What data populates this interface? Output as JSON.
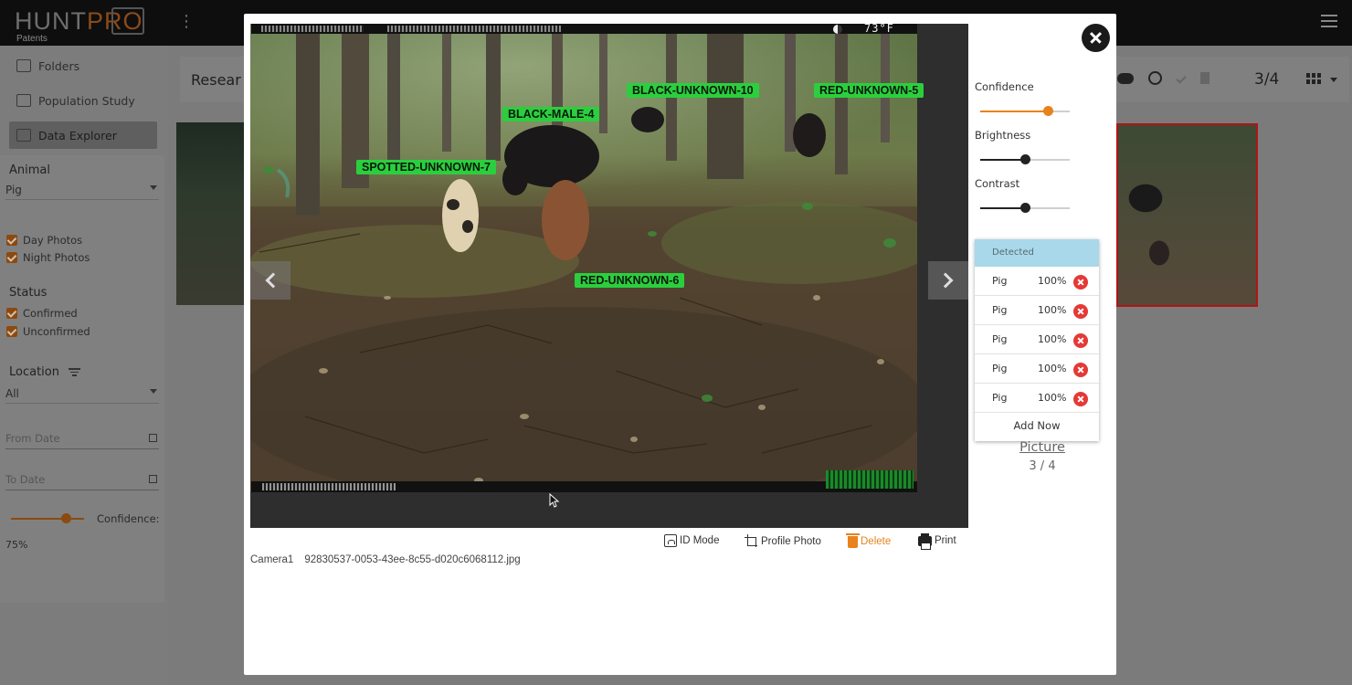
{
  "app": {
    "logo_main": "HUNT",
    "logo_accent": "PRO",
    "logo_sub": "Patents"
  },
  "sidebar": {
    "items": [
      {
        "label": "Folders",
        "icon": "folder-icon"
      },
      {
        "label": "Population Study",
        "icon": "document-icon"
      },
      {
        "label": "Data Explorer",
        "icon": "data-explorer-icon",
        "active": true
      }
    ],
    "animal_title": "Animal",
    "animal_value": "Pig",
    "day_photos": "Day Photos",
    "night_photos": "Night Photos",
    "status_title": "Status",
    "confirmed": "Confirmed",
    "unconfirmed": "Unconfirmed",
    "location_title": "Location",
    "location_value": "All",
    "from_date_placeholder": "From Date",
    "to_date_placeholder": "To Date",
    "confidence_label": "Confidence:",
    "confidence_value": "75%",
    "confidence_level": 0.75
  },
  "content": {
    "title": "Resear",
    "count": "3/4"
  },
  "viewer": {
    "temperature": "73°F",
    "detection_tags": [
      {
        "label": "BLACK-UNKNOWN-10"
      },
      {
        "label": "RED-UNKNOWN-5"
      },
      {
        "label": "BLACK-MALE-4"
      },
      {
        "label": "SPOTTED-UNKNOWN-7"
      },
      {
        "label": "RED-UNKNOWN-6"
      }
    ]
  },
  "adjustments": {
    "confidence": {
      "label": "Confidence",
      "level": 0.75,
      "color": "#e8821c"
    },
    "brightness": {
      "label": "Brightness",
      "level": 0.5,
      "color": "#222222"
    },
    "contrast": {
      "label": "Contrast",
      "level": 0.5,
      "color": "#222222"
    }
  },
  "detected": {
    "header": "Detected",
    "rows": [
      {
        "name": "Pig",
        "confidence": "100%"
      },
      {
        "name": "Pig",
        "confidence": "100%"
      },
      {
        "name": "Pig",
        "confidence": "100%"
      },
      {
        "name": "Pig",
        "confidence": "100%"
      },
      {
        "name": "Pig",
        "confidence": "100%"
      }
    ],
    "add_label": "Add Now"
  },
  "picture": {
    "label": "Picture",
    "position": "3 / 4"
  },
  "actions": {
    "id_mode": "ID Mode",
    "profile_photo": "Profile Photo",
    "delete": "Delete",
    "print": "Print"
  },
  "file": {
    "camera": "Camera1",
    "filename": "92830537-0053-43ee-8c55-d020c6068112.jpg"
  },
  "colors": {
    "accent": "#e8821c",
    "tag_green": "#2bcf3e",
    "detected_header": "#a8d8ea",
    "remove_red": "#e53935"
  }
}
